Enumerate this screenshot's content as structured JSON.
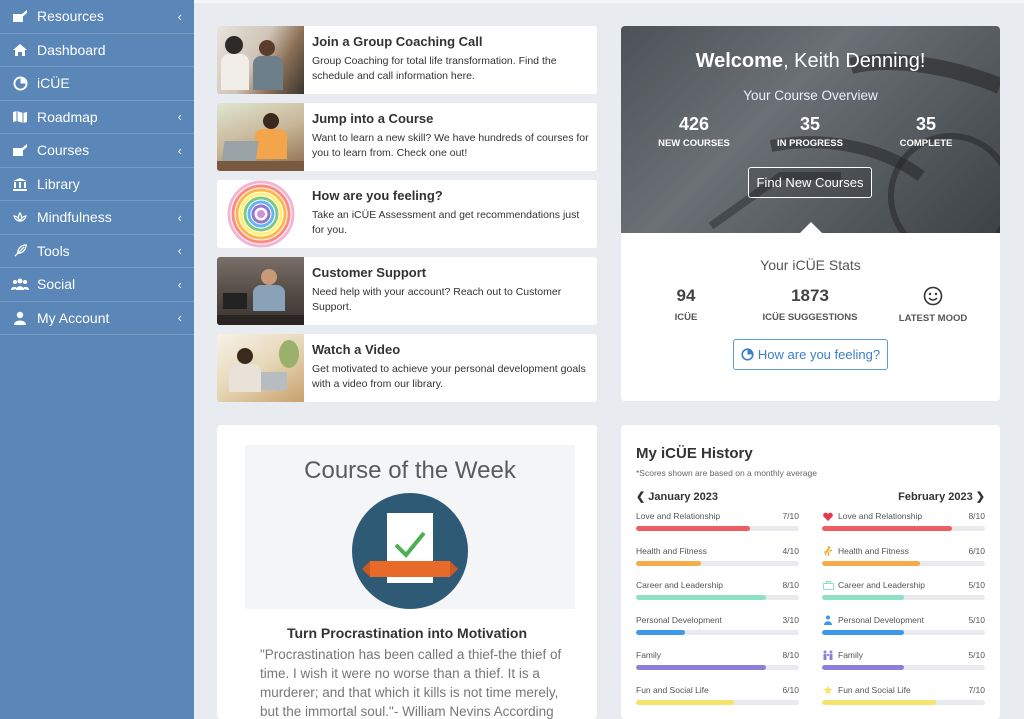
{
  "sidebar": {
    "items": [
      {
        "label": "Resources",
        "icon": "resources-icon",
        "has_chevron": true
      },
      {
        "label": "Dashboard",
        "icon": "home-icon",
        "has_chevron": false
      },
      {
        "label": "iCÜE",
        "icon": "icue-icon",
        "has_chevron": false
      },
      {
        "label": "Roadmap",
        "icon": "map-icon",
        "has_chevron": true
      },
      {
        "label": "Courses",
        "icon": "courses-icon",
        "has_chevron": true
      },
      {
        "label": "Library",
        "icon": "library-icon",
        "has_chevron": false
      },
      {
        "label": "Mindfulness",
        "icon": "lotus-icon",
        "has_chevron": true
      },
      {
        "label": "Tools",
        "icon": "feather-icon",
        "has_chevron": true
      },
      {
        "label": "Social",
        "icon": "people-icon",
        "has_chevron": true
      },
      {
        "label": "My Account",
        "icon": "user-icon",
        "has_chevron": true
      }
    ]
  },
  "actions": [
    {
      "title": "Join a Group Coaching Call",
      "desc": "Group Coaching for total life transformation. Find the schedule and call information here."
    },
    {
      "title": "Jump into a Course",
      "desc": "Want to learn a new skill? We have hundreds of courses for you to learn from. Check one out!"
    },
    {
      "title": "How are you feeling?",
      "desc": "Take an iCÜE Assessment and get recommendations just for you."
    },
    {
      "title": "Customer Support",
      "desc": "Need help with your account? Reach out to Customer Support."
    },
    {
      "title": "Watch a Video",
      "desc": "Get motivated to achieve your personal development goals with a video from our library."
    }
  ],
  "welcome": {
    "greeting": "Welcome",
    "name": ", Keith Denning!",
    "overview": "Your Course Overview",
    "stats": [
      {
        "num": "426",
        "label": "NEW COURSES"
      },
      {
        "num": "35",
        "label": "IN PROGRESS"
      },
      {
        "num": "35",
        "label": "COMPLETE"
      }
    ],
    "find_button": "Find New Courses"
  },
  "icue_stats": {
    "title": "Your iCÜE Stats",
    "icue_count": "94",
    "icue_label": "ICÜE",
    "suggestions_count": "1873",
    "suggestions_label": "ICÜE SUGGESTIONS",
    "mood_label": "LATEST MOOD",
    "mood_icon": "smiley-icon",
    "feel_button": "How are you feeling?"
  },
  "course_of_week": {
    "banner_title": "Course of the Week",
    "course_title": "Turn Procrastination into Motivation",
    "quote": "\"Procrastination has been called a thief-the thief of time. I wish it were no worse than a thief. It is a murderer; and that which it kills is not time merely, but the immortal soul.\"- William Nevins According"
  },
  "history": {
    "title": "My iCÜE History",
    "note": "*Scores shown are based on a monthly average",
    "left_month": "January 2023",
    "right_month": "February 2023",
    "categories": [
      {
        "label": "Love and Relationship",
        "color": "#ee5d62",
        "icon": "heart-icon",
        "jan": "7/10",
        "jan_val": 0.7,
        "feb": "8/10",
        "feb_val": 0.8
      },
      {
        "label": "Health and Fitness",
        "color": "#f5ac4b",
        "icon": "runner-icon",
        "jan": "4/10",
        "jan_val": 0.4,
        "feb": "6/10",
        "feb_val": 0.6
      },
      {
        "label": "Career and Leadership",
        "color": "#8ee0c6",
        "icon": "briefcase-icon",
        "jan": "8/10",
        "jan_val": 0.8,
        "feb": "5/10",
        "feb_val": 0.5
      },
      {
        "label": "Personal Development",
        "color": "#3c99e8",
        "icon": "person-icon",
        "jan": "3/10",
        "jan_val": 0.3,
        "feb": "5/10",
        "feb_val": 0.5
      },
      {
        "label": "Family",
        "color": "#8c7fdc",
        "icon": "family-icon",
        "jan": "8/10",
        "jan_val": 0.8,
        "feb": "5/10",
        "feb_val": 0.5
      },
      {
        "label": "Fun and Social Life",
        "color": "#f6e36b",
        "icon": "star-icon",
        "jan": "6/10",
        "jan_val": 0.6,
        "feb": "7/10",
        "feb_val": 0.7
      }
    ]
  }
}
